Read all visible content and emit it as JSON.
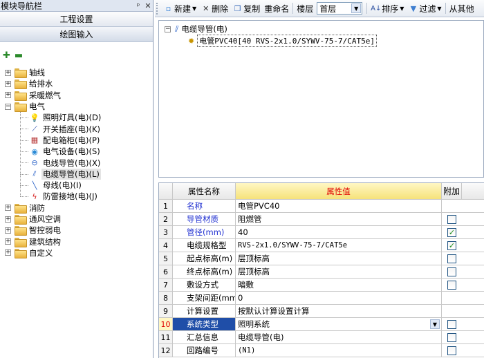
{
  "left_pane": {
    "title": "模块导航栏",
    "pin": "ᵖ",
    "close": "✕",
    "buttons": [
      "工程设置",
      "绘图输入"
    ],
    "tree": [
      {
        "label": "轴线"
      },
      {
        "label": "给排水"
      },
      {
        "label": "采暖燃气"
      },
      {
        "label": "电气",
        "expanded": true,
        "children": [
          {
            "label": "照明灯具(电)(D)",
            "icon": "bulb-icon"
          },
          {
            "label": "开关插座(电)(K)",
            "icon": "switch-icon"
          },
          {
            "label": "配电箱柜(电)(P)",
            "icon": "panel-icon"
          },
          {
            "label": "电气设备(电)(S)",
            "icon": "equipment-icon"
          },
          {
            "label": "电线导管(电)(X)",
            "icon": "wire-icon"
          },
          {
            "label": "电缆导管(电)(L)",
            "icon": "cable-icon",
            "selected": true
          },
          {
            "label": "母线(电)(I)",
            "icon": "busbar-icon"
          },
          {
            "label": "防雷接地(电)(J)",
            "icon": "lightning-icon"
          }
        ]
      },
      {
        "label": "消防"
      },
      {
        "label": "通风空调"
      },
      {
        "label": "智控弱电"
      },
      {
        "label": "建筑结构"
      },
      {
        "label": "自定义"
      }
    ]
  },
  "toolbar": {
    "new_label": "新建",
    "delete_label": "删除",
    "copy_label": "复制",
    "rename_label": "重命名",
    "floor_label": "楼层",
    "floor_value": "首层",
    "sort_label": "排序",
    "filter_label": "过滤",
    "from_other_label": "从其他"
  },
  "component_tree": {
    "root": "电缆导管(电)",
    "child": "电管PVC40[40 RVS-2x1.0/SYWV-75-7/CAT5e]"
  },
  "property_grid": {
    "headers": {
      "name": "属性名称",
      "value": "属性值",
      "add": "附加"
    },
    "rows": [
      {
        "num": "1",
        "name": "名称",
        "value": "电管PVC40",
        "blue": true,
        "checkbox": false
      },
      {
        "num": "2",
        "name": "导管材质",
        "value": "阻燃管",
        "blue": true,
        "checkbox": true,
        "checked": false
      },
      {
        "num": "3",
        "name": "管径(mm)",
        "value": "40",
        "blue": true,
        "checkbox": true,
        "checked": true
      },
      {
        "num": "4",
        "name": "电缆规格型",
        "value": "RVS-2x1.0/SYWV-75-7/CAT5e",
        "mono": true,
        "checkbox": true,
        "checked": true
      },
      {
        "num": "5",
        "name": "起点标高(m)",
        "value": "层顶标高",
        "checkbox": true,
        "checked": false
      },
      {
        "num": "6",
        "name": "终点标高(m)",
        "value": "层顶标高",
        "checkbox": true,
        "checked": false
      },
      {
        "num": "7",
        "name": "敷设方式",
        "value": "暗敷",
        "checkbox": true,
        "checked": false
      },
      {
        "num": "8",
        "name": "支架间距(mm",
        "value": "0",
        "checkbox": false
      },
      {
        "num": "9",
        "name": "计算设置",
        "value": "按默认计算设置计算",
        "checkbox": false
      },
      {
        "num": "10",
        "name": "系统类型",
        "value": "照明系统",
        "selected": true,
        "dropdown": true,
        "checkbox": true,
        "checked": false
      },
      {
        "num": "11",
        "name": "汇总信息",
        "value": "电缆导管(电)",
        "checkbox": true,
        "checked": false
      },
      {
        "num": "12",
        "name": "回路编号",
        "value": "(N1)",
        "mono": true,
        "checkbox": true,
        "checked": false
      }
    ]
  }
}
